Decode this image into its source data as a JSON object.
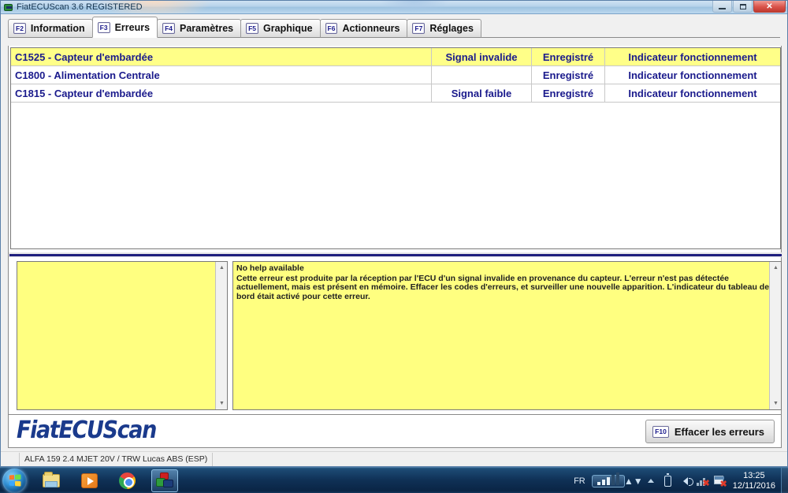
{
  "window": {
    "title": "FiatECUScan 3.6 REGISTERED",
    "app_icon": "obd-connector-icon",
    "minimize_label": "–",
    "maximize_label": "□",
    "close_label": "✕"
  },
  "tabs": [
    {
      "fkey": "F2",
      "label": "Information",
      "active": false
    },
    {
      "fkey": "F3",
      "label": "Erreurs",
      "active": true
    },
    {
      "fkey": "F4",
      "label": "Paramètres",
      "active": false
    },
    {
      "fkey": "F5",
      "label": "Graphique",
      "active": false
    },
    {
      "fkey": "F6",
      "label": "Actionneurs",
      "active": false
    },
    {
      "fkey": "F7",
      "label": "Réglages",
      "active": false
    }
  ],
  "error_table": {
    "rows": [
      {
        "code_description": "C1525 - Capteur d'embardée",
        "signal_status": "Signal invalide",
        "memory_status": "Enregistré",
        "indicator": "Indicateur fonctionnement",
        "selected": true
      },
      {
        "code_description": "C1800 - Alimentation Centrale",
        "signal_status": "",
        "memory_status": "Enregistré",
        "indicator": "Indicateur fonctionnement",
        "selected": false
      },
      {
        "code_description": "C1815 - Capteur d'embardée",
        "signal_status": "Signal faible",
        "memory_status": "Enregistré",
        "indicator": "Indicateur fonctionnement",
        "selected": false
      }
    ]
  },
  "left_panel": {
    "content": ""
  },
  "help_panel": {
    "header": "No help available",
    "body": "Cette erreur est produite par la réception par l'ECU d'un signal invalide en provenance du capteur. L'erreur n'est pas détectée actuellement, mais est présent en mémoire. Effacer les codes d'erreurs, et surveiller une nouvelle apparition. L'indicateur du tableau de bord était activé pour cette erreur."
  },
  "brand": {
    "logo_text": "FiatECUScan"
  },
  "clear_button": {
    "fkey": "F10",
    "label": "Effacer les erreurs"
  },
  "status_bar": {
    "first_segment": "",
    "ecu_info": "ALFA 159 2.4 MJET 20V / TRW Lucas ABS (ESP)",
    "rest": ""
  },
  "taskbar": {
    "start_label": "start-orb",
    "items": [
      {
        "name": "windows-explorer-icon",
        "active": false
      },
      {
        "name": "media-player-icon",
        "active": false
      },
      {
        "name": "google-chrome-icon",
        "active": false
      },
      {
        "name": "fiatecuscan-app-icon",
        "active": true
      }
    ],
    "tray": {
      "language": "FR",
      "signal_label": "signal-strength-icon",
      "hidden_label": "show-hidden-icons-icon",
      "battery_label": "battery-icon",
      "volume_label": "volume-icon",
      "network_label": "network-disconnected-icon",
      "action_center_label": "action-center-flag-icon",
      "time": "13:25",
      "date": "12/11/2016"
    }
  },
  "colors": {
    "highlight_yellow": "#ffff88",
    "panel_yellow": "#ffff80",
    "text_blue": "#1a1a8c",
    "divider_blue": "#20207e",
    "brand_blue": "#1a3a8c"
  }
}
